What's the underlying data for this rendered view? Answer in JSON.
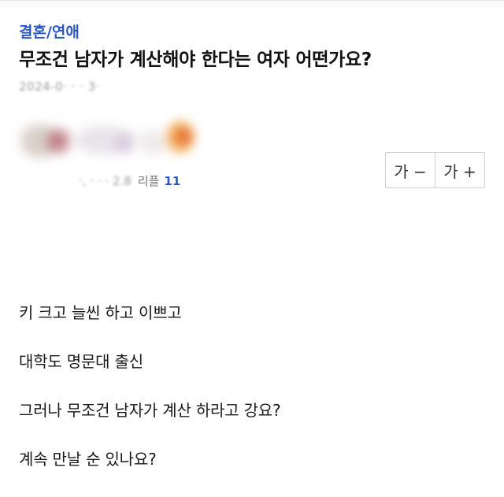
{
  "article": {
    "category": "결혼/연애",
    "title": "무조건 남자가 계산해야 한다는 여자 어떤가요?",
    "date_partial": "2024-0·  ·  ·  3·",
    "author_redacted": true
  },
  "stats": {
    "views_partial": "·,  · ·  ·  2.8",
    "replies_label": "리플",
    "replies_count": "11"
  },
  "font_controls": {
    "decrease_label": "가 −",
    "increase_label": "가 +"
  },
  "body": {
    "lines": [
      "키 크고 늘씬 하고 이쁘고",
      "대학도 명문대 출신",
      "그러나 무조건 남자가 계산 하라고 강요?",
      "계속 만날 순 있나요?"
    ]
  },
  "colors": {
    "category": "#2b56c6",
    "replies_count": "#2b56c6",
    "meta_gray": "#888888",
    "text": "#111111"
  }
}
